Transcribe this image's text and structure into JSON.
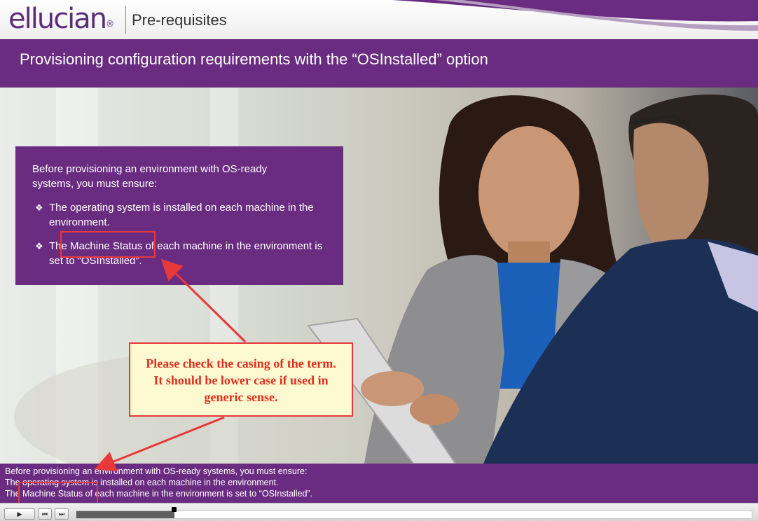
{
  "header": {
    "logo": "ellucian",
    "logo_mark": "®",
    "section_title": "Pre-requisites"
  },
  "slide": {
    "title": "Provisioning configuration requirements with the “OSInstalled” option"
  },
  "info_panel": {
    "intro": "Before provisioning an environment with OS-ready systems, you must ensure:",
    "bullets": [
      "The operating system is installed on each machine in the environment.",
      "The Machine Status of each machine in the environment is set to “OSInstalled”."
    ],
    "bullet_icon": "diamond-bullet-icon"
  },
  "callout": {
    "text": "Please check the casing of the term. It should be lower case if used in generic sense."
  },
  "caption": {
    "lines": [
      "Before provisioning an environment with OS-ready systems, you must ensure:",
      "The operating system is installed on each machine in the environment.",
      "The Machine Status of each machine in the environment is set to “OSInstalled”."
    ]
  },
  "player": {
    "play_icon": "play-icon",
    "rewind_icon": "skip-back-icon",
    "forward_icon": "skip-forward-icon",
    "progress": 0.145
  },
  "colors": {
    "brand_purple": "#6a2c80",
    "annotation_red": "#e8393a",
    "callout_bg": "#fdfad1"
  }
}
